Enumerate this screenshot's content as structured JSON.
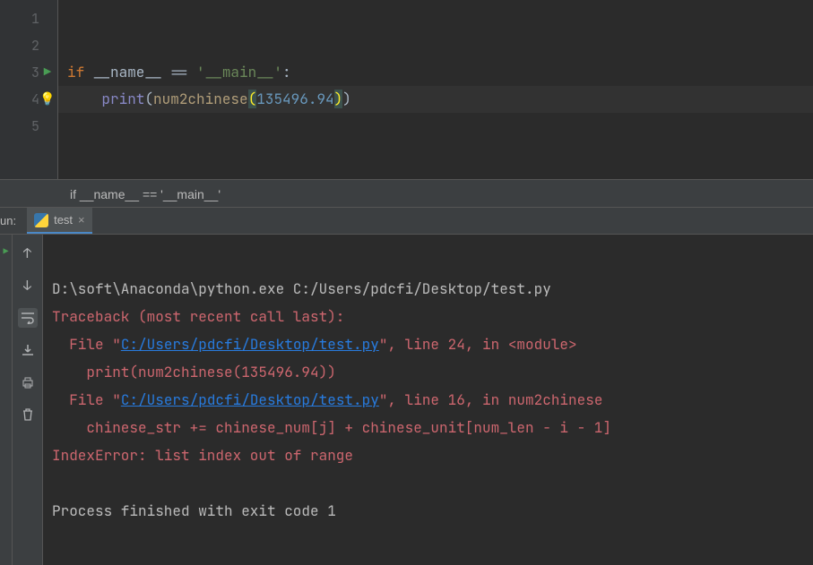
{
  "gutter": {
    "lines": [
      "1",
      "2",
      "3",
      "4",
      "5"
    ]
  },
  "code": {
    "line23": {
      "if": "if",
      "name": " __name__ ",
      "eq": "== ",
      "str": "'__main__'",
      "colon": ":"
    },
    "line24": {
      "indent": "    ",
      "print": "print",
      "open": "(",
      "fn": "num2chinese",
      "popen": "(",
      "num": "135496.94",
      "pclose": ")",
      "close": ")"
    }
  },
  "breadcrumb": "if __name__ == '__main__'",
  "run": {
    "title": "un:",
    "tab": "test"
  },
  "console": {
    "l1": "D:\\soft\\Anaconda\\python.exe C:/Users/pdcfi/Desktop/test.py",
    "l2": "Traceback (most recent call last):",
    "l3a": "  File \"",
    "l3link": "C:/Users/pdcfi/Desktop/test.py",
    "l3b": "\", line 24, in <module>",
    "l4": "    print(num2chinese(135496.94))",
    "l5a": "  File \"",
    "l5link": "C:/Users/pdcfi/Desktop/test.py",
    "l5b": "\", line 16, in num2chinese",
    "l6": "    chinese_str += chinese_num[j] + chinese_unit[num_len - i - 1]",
    "l7": "IndexError: list index out of range",
    "l8": "",
    "l9": "Process finished with exit code 1"
  }
}
